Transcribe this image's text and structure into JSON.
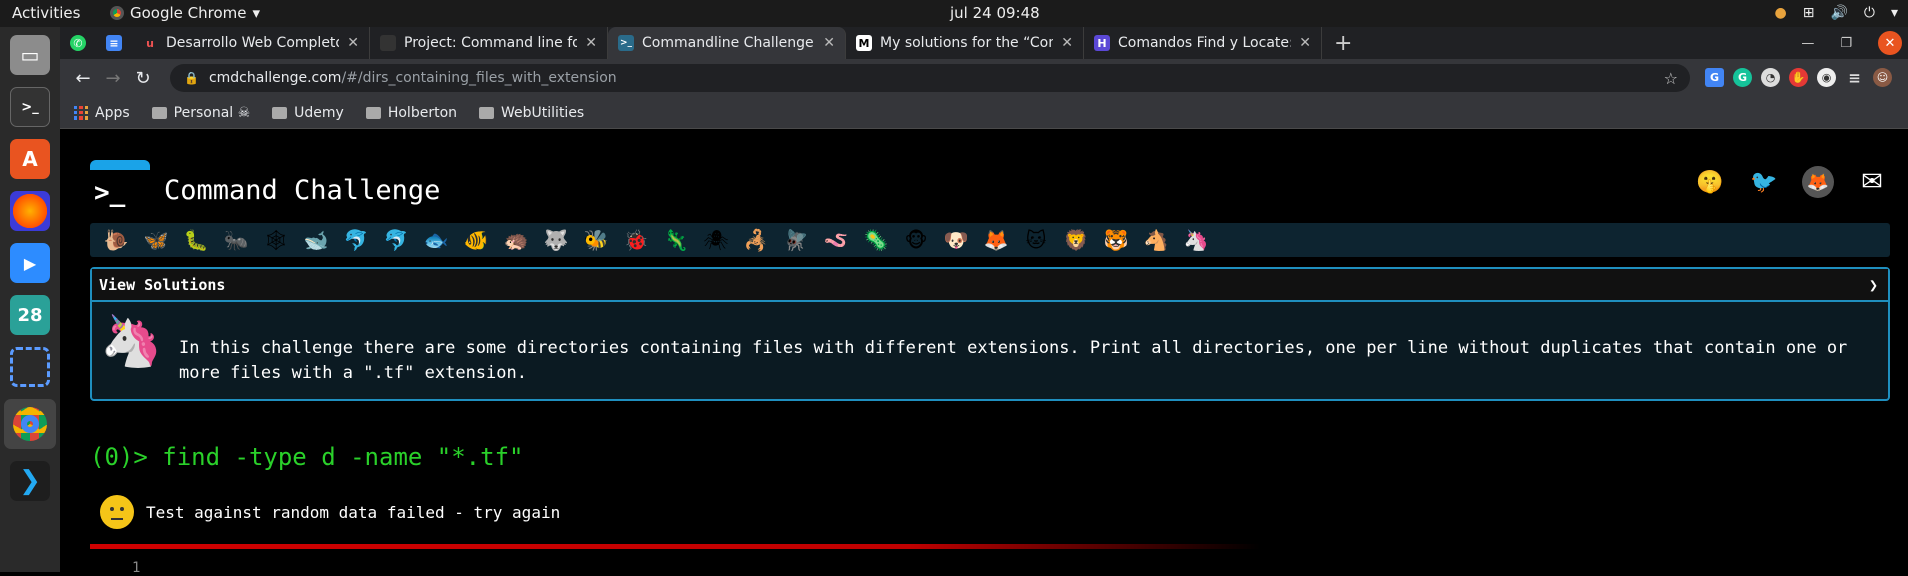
{
  "topbar": {
    "activities": "Activities",
    "app_name": "Google Chrome",
    "app_arrow": "▾",
    "clock": "jul 24  09:48"
  },
  "dock": {
    "items": [
      "files",
      "terminal",
      "software-center",
      "firefox",
      "zoom",
      "calendar",
      "screenshot",
      "chrome",
      "vscode"
    ],
    "calendar_day": "28"
  },
  "tabs": [
    {
      "title": "Desarrollo Web Completo",
      "favicon": "udemy"
    },
    {
      "title": "Project: Command line fo",
      "favicon": "holberton"
    },
    {
      "title": "Commandline Challenge",
      "favicon": "terminal",
      "active": true
    },
    {
      "title": "My solutions for the “Com",
      "favicon": "medium"
    },
    {
      "title": "Comandos Find y Locate:",
      "favicon": "blog"
    }
  ],
  "omnibox": {
    "domain": "cmdchallenge.com",
    "path": "/#/dirs_containing_files_with_extension"
  },
  "bookmarks": [
    {
      "label": "Apps",
      "type": "apps"
    },
    {
      "label": "Personal ☠",
      "type": "folder"
    },
    {
      "label": "Udemy",
      "type": "folder"
    },
    {
      "label": "Holberton",
      "type": "folder"
    },
    {
      "label": "WebUtilities",
      "type": "folder"
    }
  ],
  "site": {
    "logo_prompt": ">_",
    "title": "Command Challenge"
  },
  "levels": [
    "🐌",
    "🦋",
    "🐛",
    "🐜",
    "🕸",
    "🐋",
    "🐬",
    "🐬",
    "🐟",
    "🐠",
    "🦔",
    "🐺",
    "🐝",
    "🐞",
    "🦎",
    "🕷",
    "🦂",
    "🪰",
    "🪱",
    "🦠",
    "🐵",
    "🐶",
    "🦊",
    "🐱",
    "🦁",
    "🐯",
    "🐴",
    "🦄"
  ],
  "panel": {
    "header": "View Solutions",
    "chevron": "❯",
    "description": "In this challenge there are some directories containing files with different extensions. Print all directories, one per line without duplicates that contain one or more files with a \".tf\" extension."
  },
  "command": {
    "prefix": "(0)> ",
    "text": "find -type d -name \"*.tf\""
  },
  "result": {
    "message": "Test against random data failed - try again"
  },
  "editor": {
    "line_number": "1"
  },
  "colors": {
    "accent": "#1f8fbf",
    "prompt": "#2ad12a",
    "error": "#d00000"
  }
}
